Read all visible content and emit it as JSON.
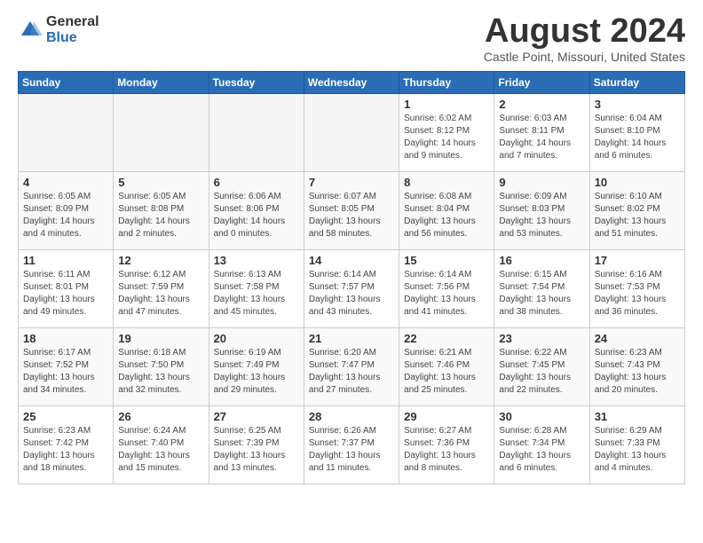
{
  "logo": {
    "general": "General",
    "blue": "Blue"
  },
  "header": {
    "title": "August 2024",
    "subtitle": "Castle Point, Missouri, United States"
  },
  "days_of_week": [
    "Sunday",
    "Monday",
    "Tuesday",
    "Wednesday",
    "Thursday",
    "Friday",
    "Saturday"
  ],
  "weeks": [
    [
      {
        "day": "",
        "empty": true
      },
      {
        "day": "",
        "empty": true
      },
      {
        "day": "",
        "empty": true
      },
      {
        "day": "",
        "empty": true
      },
      {
        "day": "1",
        "sunrise": "6:02 AM",
        "sunset": "8:12 PM",
        "daylight": "14 hours and 9 minutes."
      },
      {
        "day": "2",
        "sunrise": "6:03 AM",
        "sunset": "8:11 PM",
        "daylight": "14 hours and 7 minutes."
      },
      {
        "day": "3",
        "sunrise": "6:04 AM",
        "sunset": "8:10 PM",
        "daylight": "14 hours and 6 minutes."
      }
    ],
    [
      {
        "day": "4",
        "sunrise": "6:05 AM",
        "sunset": "8:09 PM",
        "daylight": "14 hours and 4 minutes."
      },
      {
        "day": "5",
        "sunrise": "6:05 AM",
        "sunset": "8:08 PM",
        "daylight": "14 hours and 2 minutes."
      },
      {
        "day": "6",
        "sunrise": "6:06 AM",
        "sunset": "8:06 PM",
        "daylight": "14 hours and 0 minutes."
      },
      {
        "day": "7",
        "sunrise": "6:07 AM",
        "sunset": "8:05 PM",
        "daylight": "13 hours and 58 minutes."
      },
      {
        "day": "8",
        "sunrise": "6:08 AM",
        "sunset": "8:04 PM",
        "daylight": "13 hours and 56 minutes."
      },
      {
        "day": "9",
        "sunrise": "6:09 AM",
        "sunset": "8:03 PM",
        "daylight": "13 hours and 53 minutes."
      },
      {
        "day": "10",
        "sunrise": "6:10 AM",
        "sunset": "8:02 PM",
        "daylight": "13 hours and 51 minutes."
      }
    ],
    [
      {
        "day": "11",
        "sunrise": "6:11 AM",
        "sunset": "8:01 PM",
        "daylight": "13 hours and 49 minutes."
      },
      {
        "day": "12",
        "sunrise": "6:12 AM",
        "sunset": "7:59 PM",
        "daylight": "13 hours and 47 minutes."
      },
      {
        "day": "13",
        "sunrise": "6:13 AM",
        "sunset": "7:58 PM",
        "daylight": "13 hours and 45 minutes."
      },
      {
        "day": "14",
        "sunrise": "6:14 AM",
        "sunset": "7:57 PM",
        "daylight": "13 hours and 43 minutes."
      },
      {
        "day": "15",
        "sunrise": "6:14 AM",
        "sunset": "7:56 PM",
        "daylight": "13 hours and 41 minutes."
      },
      {
        "day": "16",
        "sunrise": "6:15 AM",
        "sunset": "7:54 PM",
        "daylight": "13 hours and 38 minutes."
      },
      {
        "day": "17",
        "sunrise": "6:16 AM",
        "sunset": "7:53 PM",
        "daylight": "13 hours and 36 minutes."
      }
    ],
    [
      {
        "day": "18",
        "sunrise": "6:17 AM",
        "sunset": "7:52 PM",
        "daylight": "13 hours and 34 minutes."
      },
      {
        "day": "19",
        "sunrise": "6:18 AM",
        "sunset": "7:50 PM",
        "daylight": "13 hours and 32 minutes."
      },
      {
        "day": "20",
        "sunrise": "6:19 AM",
        "sunset": "7:49 PM",
        "daylight": "13 hours and 29 minutes."
      },
      {
        "day": "21",
        "sunrise": "6:20 AM",
        "sunset": "7:47 PM",
        "daylight": "13 hours and 27 minutes."
      },
      {
        "day": "22",
        "sunrise": "6:21 AM",
        "sunset": "7:46 PM",
        "daylight": "13 hours and 25 minutes."
      },
      {
        "day": "23",
        "sunrise": "6:22 AM",
        "sunset": "7:45 PM",
        "daylight": "13 hours and 22 minutes."
      },
      {
        "day": "24",
        "sunrise": "6:23 AM",
        "sunset": "7:43 PM",
        "daylight": "13 hours and 20 minutes."
      }
    ],
    [
      {
        "day": "25",
        "sunrise": "6:23 AM",
        "sunset": "7:42 PM",
        "daylight": "13 hours and 18 minutes."
      },
      {
        "day": "26",
        "sunrise": "6:24 AM",
        "sunset": "7:40 PM",
        "daylight": "13 hours and 15 minutes."
      },
      {
        "day": "27",
        "sunrise": "6:25 AM",
        "sunset": "7:39 PM",
        "daylight": "13 hours and 13 minutes."
      },
      {
        "day": "28",
        "sunrise": "6:26 AM",
        "sunset": "7:37 PM",
        "daylight": "13 hours and 11 minutes."
      },
      {
        "day": "29",
        "sunrise": "6:27 AM",
        "sunset": "7:36 PM",
        "daylight": "13 hours and 8 minutes."
      },
      {
        "day": "30",
        "sunrise": "6:28 AM",
        "sunset": "7:34 PM",
        "daylight": "13 hours and 6 minutes."
      },
      {
        "day": "31",
        "sunrise": "6:29 AM",
        "sunset": "7:33 PM",
        "daylight": "13 hours and 4 minutes."
      }
    ]
  ]
}
